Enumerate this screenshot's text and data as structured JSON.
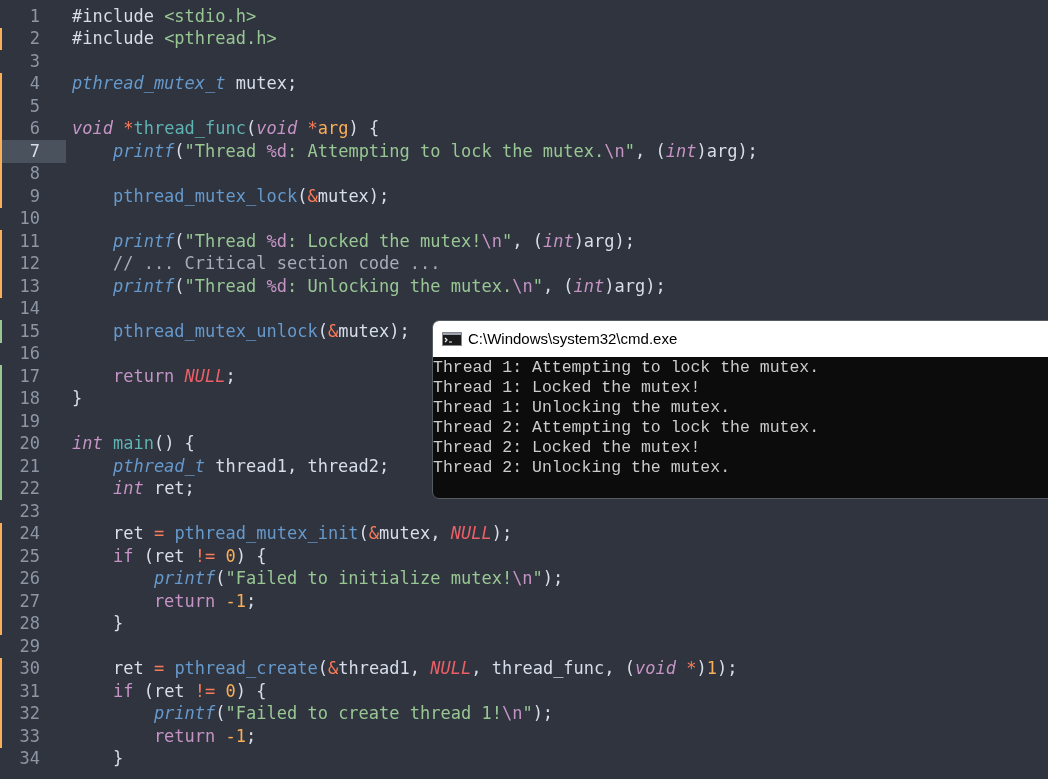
{
  "editor": {
    "lines": [
      {
        "number": "1",
        "kind": "unchanged",
        "current": false,
        "tokens": [
          {
            "kind": "directive",
            "text": "#include "
          },
          {
            "kind": "include",
            "text": "<stdio.h>"
          }
        ]
      },
      {
        "number": "2",
        "kind": "modified",
        "current": false,
        "tokens": [
          {
            "kind": "directive",
            "text": "#include "
          },
          {
            "kind": "include",
            "text": "<pthread.h>"
          }
        ]
      },
      {
        "number": "3",
        "kind": "unchanged",
        "current": false
      },
      {
        "number": "4",
        "kind": "modified",
        "current": false,
        "tokens": [
          {
            "kind": "typename",
            "text": "pthread_mutex_t"
          },
          {
            "kind": "plain",
            "text": " mutex;"
          }
        ]
      },
      {
        "number": "5",
        "kind": "modified",
        "current": false
      },
      {
        "number": "6",
        "kind": "modified",
        "current": false,
        "tokens": [
          {
            "kind": "type",
            "text": "void "
          },
          {
            "kind": "op",
            "text": "*"
          },
          {
            "kind": "defn",
            "text": "thread_func"
          },
          {
            "kind": "plain",
            "text": "("
          },
          {
            "kind": "type",
            "text": "void "
          },
          {
            "kind": "op",
            "text": "*"
          },
          {
            "kind": "param",
            "text": "arg"
          },
          {
            "kind": "plain",
            "text": ") {"
          }
        ]
      },
      {
        "number": "7",
        "kind": "modified",
        "current": true,
        "tokens": [
          {
            "kind": "callitalic",
            "text": "    printf"
          },
          {
            "kind": "plain",
            "text": "("
          },
          {
            "kind": "string",
            "text": "\"Thread "
          },
          {
            "kind": "escape",
            "text": "%d"
          },
          {
            "kind": "string",
            "text": ": Attempting to lock the mutex."
          },
          {
            "kind": "escape",
            "text": "\\n"
          },
          {
            "kind": "string",
            "text": "\""
          },
          {
            "kind": "plain",
            "text": ", ("
          },
          {
            "kind": "type",
            "text": "int"
          },
          {
            "kind": "plain",
            "text": ")arg);"
          }
        ]
      },
      {
        "number": "8",
        "kind": "modified",
        "current": false
      },
      {
        "number": "9",
        "kind": "modified",
        "current": false,
        "tokens": [
          {
            "kind": "call",
            "text": "    pthread_mutex_lock"
          },
          {
            "kind": "plain",
            "text": "("
          },
          {
            "kind": "op",
            "text": "&"
          },
          {
            "kind": "plain",
            "text": "mutex);"
          }
        ]
      },
      {
        "number": "10",
        "kind": "unchanged",
        "current": false
      },
      {
        "number": "11",
        "kind": "modified",
        "current": false,
        "tokens": [
          {
            "kind": "callitalic",
            "text": "    printf"
          },
          {
            "kind": "plain",
            "text": "("
          },
          {
            "kind": "string",
            "text": "\"Thread "
          },
          {
            "kind": "escape",
            "text": "%d"
          },
          {
            "kind": "string",
            "text": ": Locked the mutex!"
          },
          {
            "kind": "escape",
            "text": "\\n"
          },
          {
            "kind": "string",
            "text": "\""
          },
          {
            "kind": "plain",
            "text": ", ("
          },
          {
            "kind": "type",
            "text": "int"
          },
          {
            "kind": "plain",
            "text": ")arg);"
          }
        ]
      },
      {
        "number": "12",
        "kind": "modified",
        "current": false,
        "tokens": [
          {
            "kind": "comment",
            "text": "    // ... Critical section code ..."
          }
        ]
      },
      {
        "number": "13",
        "kind": "modified",
        "current": false,
        "tokens": [
          {
            "kind": "callitalic",
            "text": "    printf"
          },
          {
            "kind": "plain",
            "text": "("
          },
          {
            "kind": "string",
            "text": "\"Thread "
          },
          {
            "kind": "escape",
            "text": "%d"
          },
          {
            "kind": "string",
            "text": ": Unlocking the mutex."
          },
          {
            "kind": "escape",
            "text": "\\n"
          },
          {
            "kind": "string",
            "text": "\""
          },
          {
            "kind": "plain",
            "text": ", ("
          },
          {
            "kind": "type",
            "text": "int"
          },
          {
            "kind": "plain",
            "text": ")arg);"
          }
        ]
      },
      {
        "number": "14",
        "kind": "unchanged",
        "current": false
      },
      {
        "number": "15",
        "kind": "added",
        "current": false,
        "tokens": [
          {
            "kind": "call",
            "text": "    pthread_mutex_unlock"
          },
          {
            "kind": "plain",
            "text": "("
          },
          {
            "kind": "op",
            "text": "&"
          },
          {
            "kind": "plain",
            "text": "mutex);"
          }
        ]
      },
      {
        "number": "16",
        "kind": "unchanged",
        "current": false
      },
      {
        "number": "17",
        "kind": "added",
        "current": false,
        "tokens": [
          {
            "kind": "keyword",
            "text": "    return "
          },
          {
            "kind": "null",
            "text": "NULL"
          },
          {
            "kind": "plain",
            "text": ";"
          }
        ]
      },
      {
        "number": "18",
        "kind": "added",
        "current": false,
        "tokens": [
          {
            "kind": "plain",
            "text": "}"
          }
        ]
      },
      {
        "number": "19",
        "kind": "added",
        "current": false
      },
      {
        "number": "20",
        "kind": "added",
        "current": false,
        "tokens": [
          {
            "kind": "type",
            "text": "int "
          },
          {
            "kind": "defn",
            "text": "main"
          },
          {
            "kind": "plain",
            "text": "() {"
          }
        ]
      },
      {
        "number": "21",
        "kind": "added",
        "current": false,
        "tokens": [
          {
            "kind": "typename",
            "text": "    pthread_t"
          },
          {
            "kind": "plain",
            "text": " thread1, thread2;"
          }
        ]
      },
      {
        "number": "22",
        "kind": "added",
        "current": false,
        "tokens": [
          {
            "kind": "type",
            "text": "    int"
          },
          {
            "kind": "plain",
            "text": " ret;"
          }
        ]
      },
      {
        "number": "23",
        "kind": "unchanged",
        "current": false
      },
      {
        "number": "24",
        "kind": "modified",
        "current": false,
        "tokens": [
          {
            "kind": "plain",
            "text": "    ret "
          },
          {
            "kind": "op",
            "text": "="
          },
          {
            "kind": "call",
            "text": " pthread_mutex_init"
          },
          {
            "kind": "plain",
            "text": "("
          },
          {
            "kind": "op",
            "text": "&"
          },
          {
            "kind": "plain",
            "text": "mutex, "
          },
          {
            "kind": "null",
            "text": "NULL"
          },
          {
            "kind": "plain",
            "text": ");"
          }
        ]
      },
      {
        "number": "25",
        "kind": "modified",
        "current": false,
        "tokens": [
          {
            "kind": "keyword",
            "text": "    if"
          },
          {
            "kind": "plain",
            "text": " (ret "
          },
          {
            "kind": "op",
            "text": "!="
          },
          {
            "kind": "number",
            "text": " 0"
          },
          {
            "kind": "plain",
            "text": ") {"
          }
        ]
      },
      {
        "number": "26",
        "kind": "modified",
        "current": false,
        "tokens": [
          {
            "kind": "callitalic",
            "text": "        printf"
          },
          {
            "kind": "plain",
            "text": "("
          },
          {
            "kind": "string",
            "text": "\"Failed to initialize mutex!"
          },
          {
            "kind": "escape",
            "text": "\\n"
          },
          {
            "kind": "string",
            "text": "\""
          },
          {
            "kind": "plain",
            "text": ");"
          }
        ]
      },
      {
        "number": "27",
        "kind": "modified",
        "current": false,
        "tokens": [
          {
            "kind": "keyword",
            "text": "        return "
          },
          {
            "kind": "number",
            "text": "-1"
          },
          {
            "kind": "plain",
            "text": ";"
          }
        ]
      },
      {
        "number": "28",
        "kind": "modified",
        "current": false,
        "tokens": [
          {
            "kind": "plain",
            "text": "    }"
          }
        ]
      },
      {
        "number": "29",
        "kind": "unchanged",
        "current": false
      },
      {
        "number": "30",
        "kind": "modified",
        "current": false,
        "tokens": [
          {
            "kind": "plain",
            "text": "    ret "
          },
          {
            "kind": "op",
            "text": "="
          },
          {
            "kind": "call",
            "text": " pthread_create"
          },
          {
            "kind": "plain",
            "text": "("
          },
          {
            "kind": "op",
            "text": "&"
          },
          {
            "kind": "plain",
            "text": "thread1, "
          },
          {
            "kind": "null",
            "text": "NULL"
          },
          {
            "kind": "plain",
            "text": ", thread_func, ("
          },
          {
            "kind": "type",
            "text": "void "
          },
          {
            "kind": "op",
            "text": "*"
          },
          {
            "kind": "plain",
            "text": ")"
          },
          {
            "kind": "number",
            "text": "1"
          },
          {
            "kind": "plain",
            "text": ");"
          }
        ]
      },
      {
        "number": "31",
        "kind": "modified",
        "current": false,
        "tokens": [
          {
            "kind": "keyword",
            "text": "    if"
          },
          {
            "kind": "plain",
            "text": " (ret "
          },
          {
            "kind": "op",
            "text": "!="
          },
          {
            "kind": "number",
            "text": " 0"
          },
          {
            "kind": "plain",
            "text": ") {"
          }
        ]
      },
      {
        "number": "32",
        "kind": "modified",
        "current": false,
        "tokens": [
          {
            "kind": "callitalic",
            "text": "        printf"
          },
          {
            "kind": "plain",
            "text": "("
          },
          {
            "kind": "string",
            "text": "\"Failed to create thread 1!"
          },
          {
            "kind": "escape",
            "text": "\\n"
          },
          {
            "kind": "string",
            "text": "\""
          },
          {
            "kind": "plain",
            "text": ");"
          }
        ]
      },
      {
        "number": "33",
        "kind": "modified",
        "current": false,
        "tokens": [
          {
            "kind": "keyword",
            "text": "        return "
          },
          {
            "kind": "number",
            "text": "-1"
          },
          {
            "kind": "plain",
            "text": ";"
          }
        ]
      },
      {
        "number": "34",
        "kind": "unchanged",
        "current": false,
        "tokens": [
          {
            "kind": "plain",
            "text": "    }"
          }
        ]
      }
    ]
  },
  "console": {
    "title": "C:\\Windows\\system32\\cmd.exe",
    "lines": [
      "Thread 1: Attempting to lock the mutex.",
      "Thread 1: Locked the mutex!",
      "Thread 1: Unlocking the mutex.",
      "Thread 2: Attempting to lock the mutex.",
      "Thread 2: Locked the mutex!",
      "Thread 2: Unlocking the mutex."
    ]
  }
}
